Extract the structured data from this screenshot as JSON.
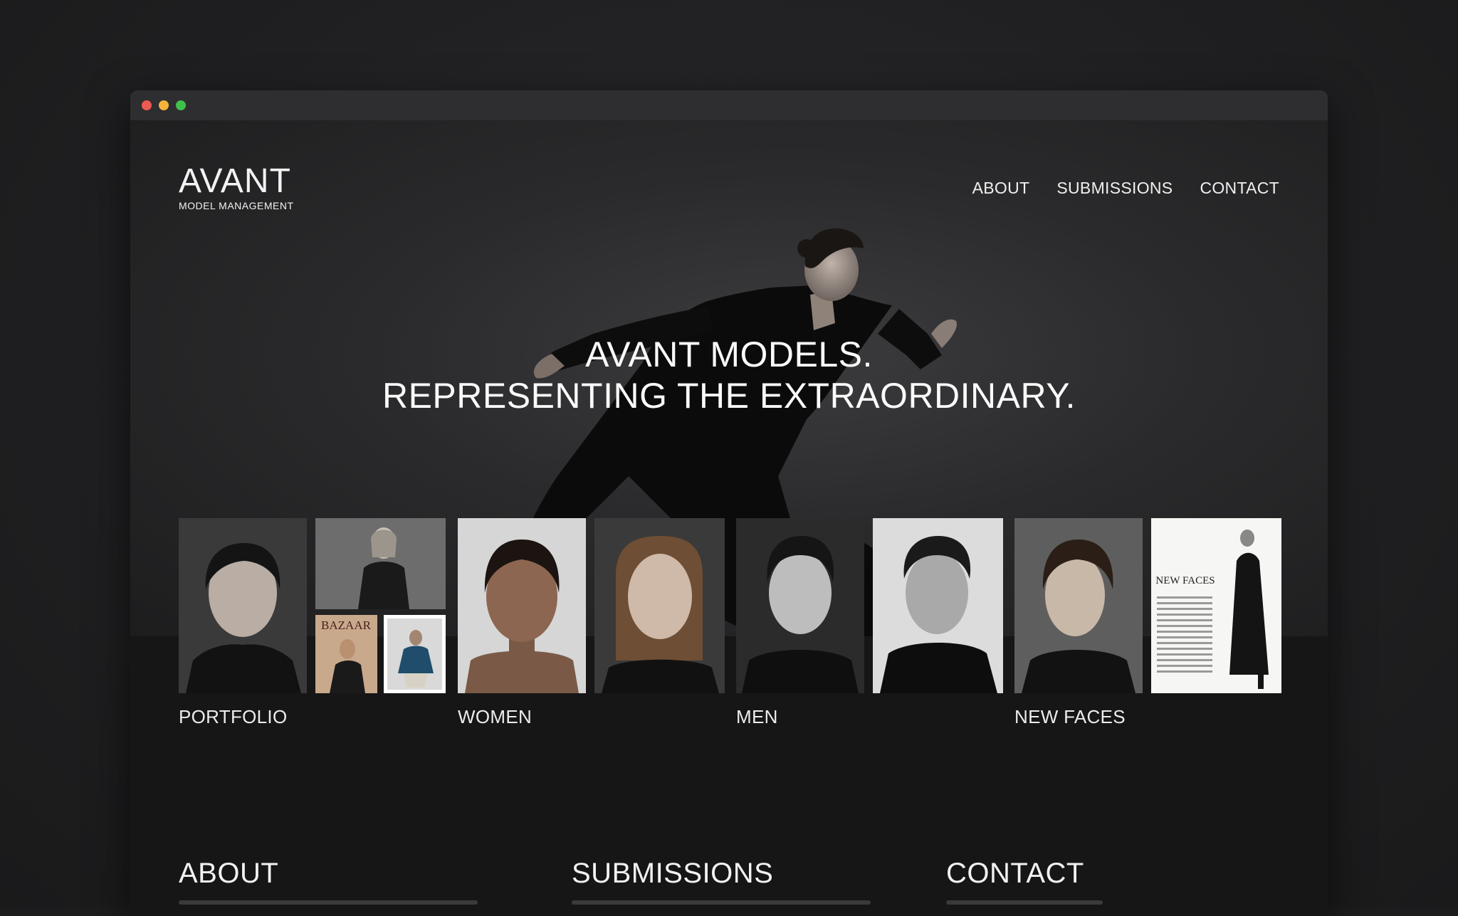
{
  "logo": {
    "main": "AVANT",
    "sub": "MODEL MANAGEMENT"
  },
  "nav": [
    "ABOUT",
    "SUBMISSIONS",
    "CONTACT"
  ],
  "hero": {
    "line1": "AVANT MODELS.",
    "line2": "REPRESENTING THE EXTRAORDINARY."
  },
  "categories": [
    "PORTFOLIO",
    "WOMEN",
    "MEN",
    "NEW FACES"
  ],
  "magazine": {
    "baazar": "BAZAAR",
    "newfaces": "NEW FACES"
  },
  "sections": [
    "ABOUT",
    "SUBMISSIONS",
    "CONTACT"
  ],
  "colors": {
    "background": "#1f1f21",
    "window": "#161617",
    "text": "#f2f2f2"
  }
}
